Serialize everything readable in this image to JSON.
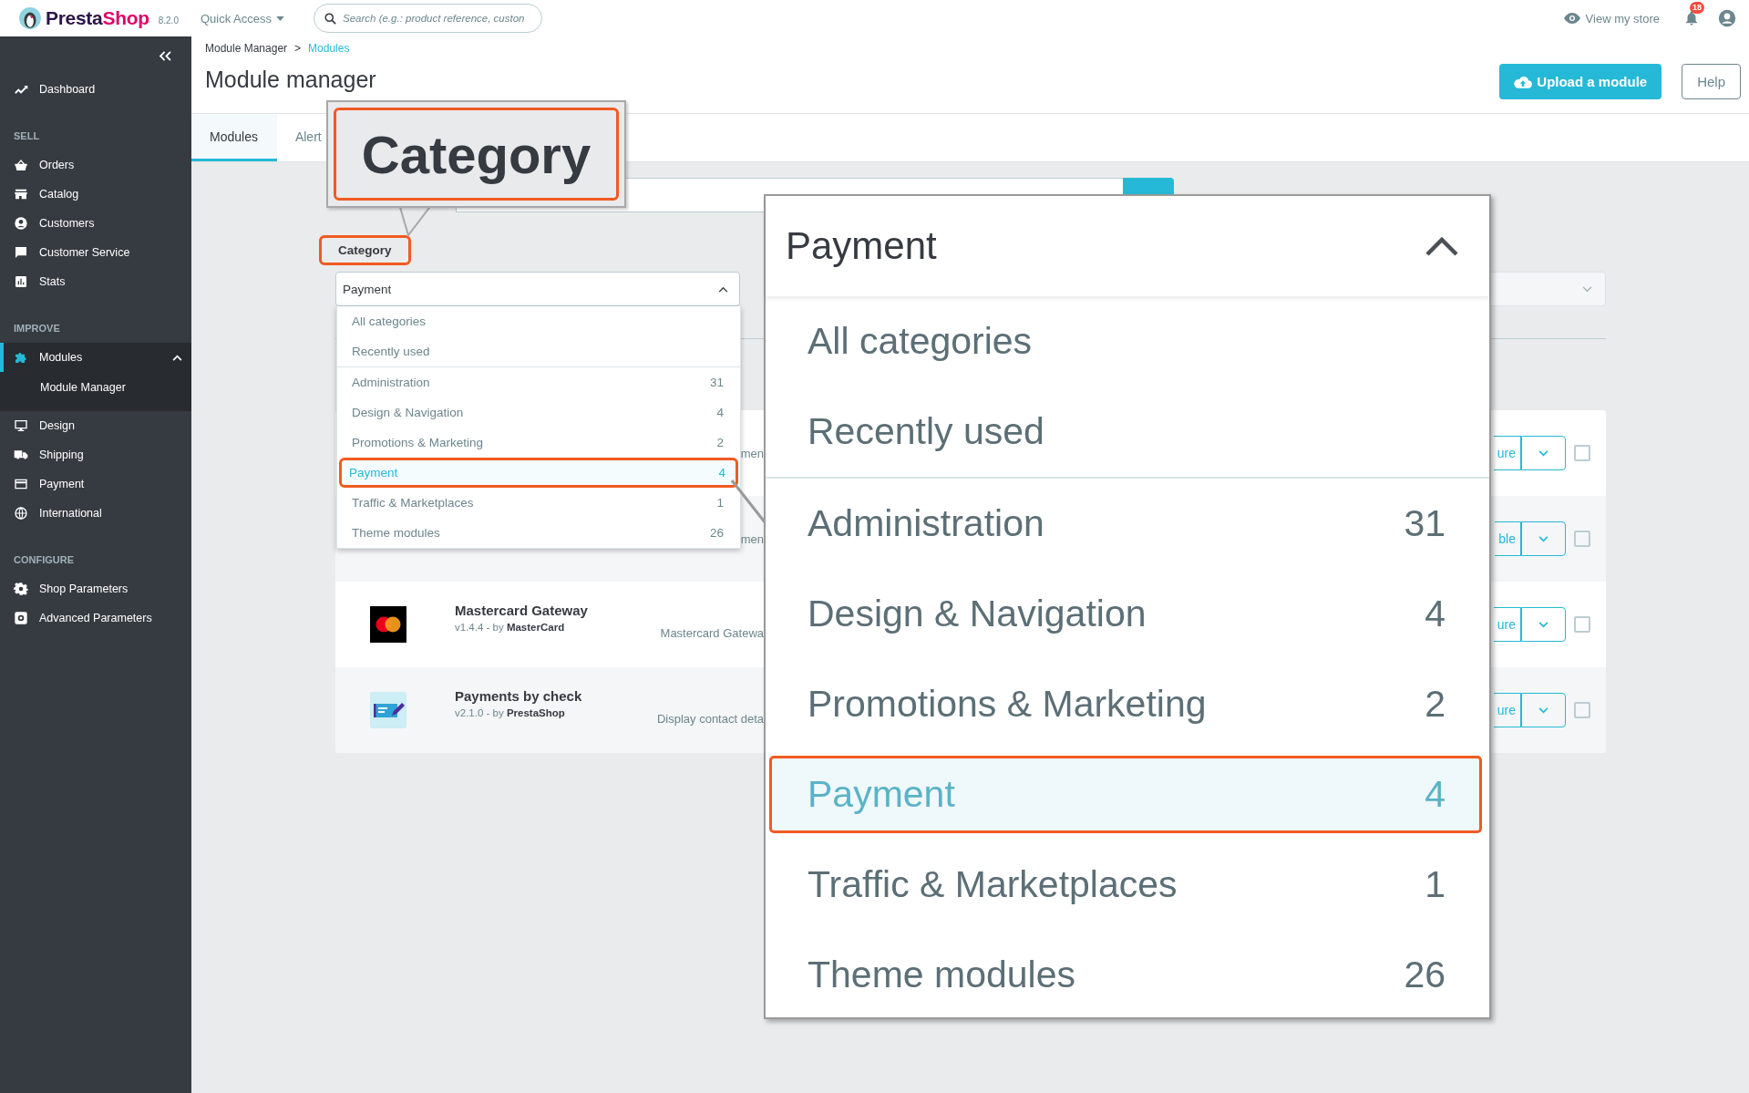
{
  "topbar": {
    "brand_parts": [
      "Presta",
      "Shop"
    ],
    "version": "8.2.0",
    "quick_access": "Quick Access",
    "search": {
      "placeholder": "Search (e.g.: product reference, custon"
    },
    "view_store": "View my store",
    "notification_count": "18"
  },
  "sidebar": {
    "items": [
      {
        "label": "Dashboard",
        "selected": false
      }
    ],
    "sections": [
      {
        "title": "SELL",
        "items": [
          {
            "label": "Orders",
            "selected": false
          },
          {
            "label": "Catalog",
            "selected": false
          },
          {
            "label": "Customers",
            "selected": false
          },
          {
            "label": "Customer Service",
            "selected": false
          },
          {
            "label": "Stats",
            "selected": false
          }
        ]
      },
      {
        "title": "IMPROVE",
        "items": [
          {
            "label": "Modules",
            "selected": true,
            "expanded": true,
            "children": [
              {
                "label": "Module Manager",
                "selected": true
              }
            ]
          },
          {
            "label": "Design",
            "selected": false
          },
          {
            "label": "Shipping",
            "selected": false
          },
          {
            "label": "Payment",
            "selected": false
          },
          {
            "label": "International",
            "selected": false
          }
        ]
      },
      {
        "title": "CONFIGURE",
        "items": [
          {
            "label": "Shop Parameters",
            "selected": false
          },
          {
            "label": "Advanced Parameters",
            "selected": false
          }
        ]
      }
    ]
  },
  "page": {
    "breadcrumb": [
      {
        "label": "Module Manager",
        "selected": false
      },
      {
        "label": "Modules",
        "selected": true
      }
    ],
    "breadcrumb_separator": ">",
    "title": "Module manager",
    "buttons": [
      {
        "kind": "primary",
        "label": "Upload a module"
      },
      {
        "kind": "outline",
        "label": "Help"
      }
    ]
  },
  "tabs": [
    {
      "label": "Modules",
      "selected": true
    },
    {
      "label": "Alert",
      "selected": false
    }
  ],
  "filters": {
    "category_label": "Category",
    "category_select": {
      "value": "Payment",
      "expanded": true,
      "option_groups": [
        [
          {
            "label": "All categories",
            "selected": false
          },
          {
            "label": "Recently used",
            "selected": false
          }
        ],
        [
          {
            "label": "Administration",
            "count": "31",
            "selected": false
          },
          {
            "label": "Design & Navigation",
            "count": "4",
            "selected": false
          },
          {
            "label": "Promotions & Marketing",
            "count": "2",
            "selected": false
          },
          {
            "label": "Payment",
            "count": "4",
            "selected": true
          },
          {
            "label": "Traffic & Marketplaces",
            "count": "1",
            "selected": false
          },
          {
            "label": "Theme modules",
            "count": "26",
            "selected": false
          }
        ]
      ]
    }
  },
  "modules": [
    {
      "kind": "covered",
      "description": "men",
      "action": "ure",
      "checked": false
    },
    {
      "kind": "covered",
      "description": "men",
      "action": "ble",
      "checked": false
    },
    {
      "kind": "mastercard",
      "name": "Mastercard Gateway",
      "version": "v1.4.4 - by",
      "author": "MasterCard",
      "description": "Mastercard Gatewa",
      "action": "ure",
      "checked": false
    },
    {
      "kind": "check",
      "name": "Payments by check",
      "version": "v2.1.0 - by",
      "author": "PrestaShop",
      "description": "Display contact deta",
      "action": "ure",
      "checked": false
    }
  ],
  "callouts": {
    "label_zoom": "Category",
    "dropdown_zoom": {
      "value": "Payment",
      "expanded": true,
      "option_groups": [
        [
          {
            "label": "All categories",
            "selected": false
          },
          {
            "label": "Recently used",
            "selected": false
          }
        ],
        [
          {
            "label": "Administration",
            "count": "31",
            "selected": false
          },
          {
            "label": "Design & Navigation",
            "count": "4",
            "selected": false
          },
          {
            "label": "Promotions & Marketing",
            "count": "2",
            "selected": false
          },
          {
            "label": "Payment",
            "count": "4",
            "selected": true
          },
          {
            "label": "Traffic & Marketplaces",
            "count": "1",
            "selected": false
          },
          {
            "label": "Theme modules",
            "count": "26",
            "selected": false
          }
        ]
      ]
    }
  }
}
